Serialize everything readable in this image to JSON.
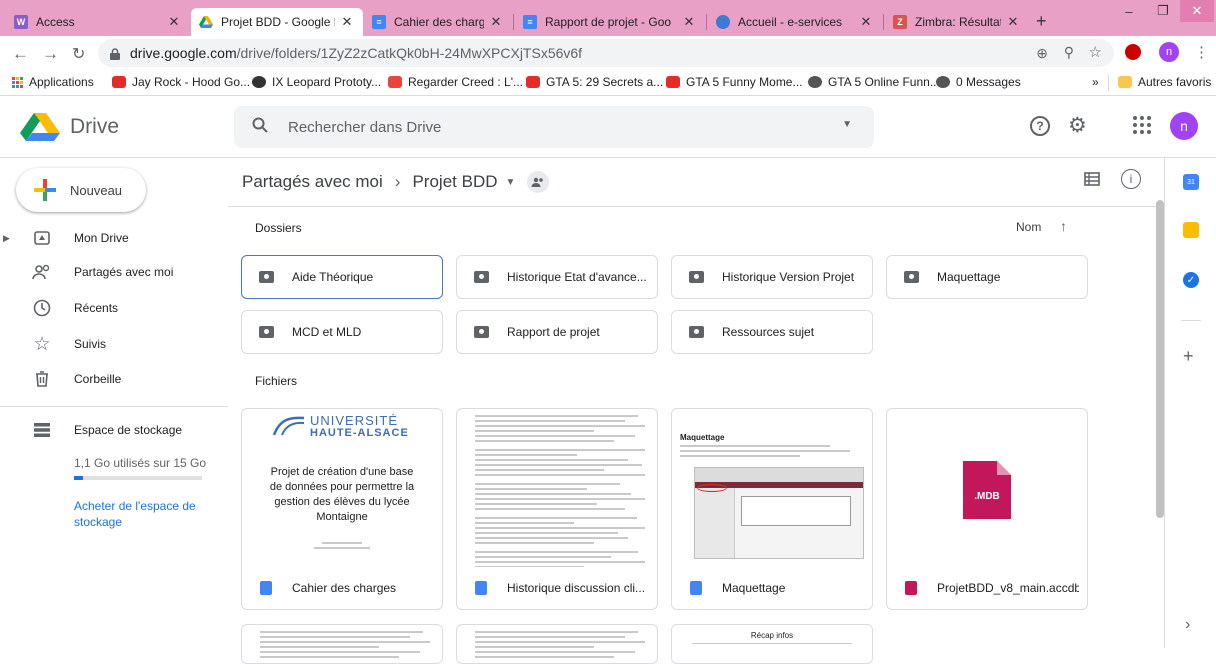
{
  "browser": {
    "tabs": [
      {
        "title": "Access",
        "favicon_color": "#8a5cc9",
        "favicon_text": "W"
      },
      {
        "title": "Projet BDD - Google Dri",
        "favicon_color": "#f4b400",
        "favicon_text": ""
      },
      {
        "title": "Cahier des charges - Go",
        "favicon_color": "#4285f4",
        "favicon_text": "≡"
      },
      {
        "title": "Rapport de projet - Goo",
        "favicon_color": "#4285f4",
        "favicon_text": "≡"
      },
      {
        "title": "Accueil - e-services",
        "favicon_color": "#3b7bd4",
        "favicon_text": ""
      },
      {
        "title": "Zimbra: Résultats de rec",
        "favicon_color": "#d9534f",
        "favicon_text": "Z"
      }
    ],
    "new_tab_label": "+",
    "url_host": "drive.google.com",
    "url_path": "/drive/folders/1ZyZ2zCatkQk0bH-24MwXPCXjTSx56v6f",
    "profile_initial": "n",
    "bookmarks": [
      {
        "label": "Applications",
        "color": "#1a73e8"
      },
      {
        "label": "Jay Rock - Hood Go...",
        "color": "#e52d27"
      },
      {
        "label": "IX Leopard Prototy...",
        "color": "#333333"
      },
      {
        "label": "Regarder Creed : L'...",
        "color": "#e8453c"
      },
      {
        "label": "GTA 5: 29 Secrets a...",
        "color": "#e52d27"
      },
      {
        "label": "GTA 5 Funny Mome...",
        "color": "#e52d27"
      },
      {
        "label": "GTA 5 Online Funn...",
        "color": "#555555"
      },
      {
        "label": "0 Messages",
        "color": "#555555"
      }
    ],
    "bookmarks_overflow": "»",
    "other_bookmarks": "Autres favoris"
  },
  "drive": {
    "product_name": "Drive",
    "search_placeholder": "Rechercher dans Drive",
    "user_initial": "n",
    "new_button": "Nouveau",
    "nav": [
      {
        "label": "Mon Drive",
        "icon": "drive-icon"
      },
      {
        "label": "Partagés avec moi",
        "icon": "shared-people-icon"
      },
      {
        "label": "Récents",
        "icon": "clock-icon"
      },
      {
        "label": "Suivis",
        "icon": "star-icon"
      },
      {
        "label": "Corbeille",
        "icon": "trash-icon"
      }
    ],
    "storage": {
      "label": "Espace de stockage",
      "usage": "1,1 Go utilisés sur 15 Go",
      "used_fraction": 0.073,
      "buy_link": "Acheter de l'espace de stockage"
    },
    "breadcrumb": {
      "parent": "Partagés avec moi",
      "separator": "›",
      "current": "Projet BDD"
    },
    "sort": {
      "label": "Nom",
      "direction": "↑"
    },
    "folders_heading": "Dossiers",
    "folders": [
      "Aide Théorique",
      "Historique Etat d'avance...",
      "Historique Version Projet",
      "Maquettage",
      "MCD et MLD",
      "Rapport de projet",
      "Ressources sujet"
    ],
    "files_heading": "Fichiers",
    "files": [
      {
        "name": "Cahier des charges",
        "type": "doc",
        "color": "#4285f4"
      },
      {
        "name": "Historique discussion cli...",
        "type": "doc",
        "color": "#4285f4"
      },
      {
        "name": "Maquettage",
        "type": "doc",
        "color": "#4285f4"
      },
      {
        "name": "ProjetBDD_v8_main.accdb",
        "type": "file",
        "color": "#c2185b"
      }
    ],
    "thumb1": {
      "logo_top": "UNIVERSITÉ",
      "logo_bottom": "HAUTE-ALSACE",
      "title": "Projet de création d'une base de données pour permettre la gestion des élèves du lycée Montaigne"
    },
    "thumb3_heading": "Maquettage",
    "thumb4_badge": ".MDB",
    "row2_thumb3_title": "Récap infos"
  }
}
